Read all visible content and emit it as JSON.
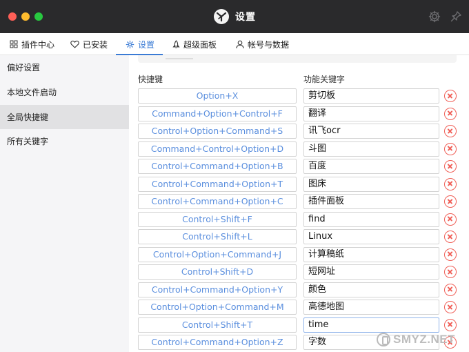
{
  "window": {
    "title": "设置"
  },
  "tabs": [
    {
      "label": "插件中心",
      "icon": "grid-icon"
    },
    {
      "label": "已安装",
      "icon": "heart-icon"
    },
    {
      "label": "设置",
      "icon": "gear-icon",
      "active": true
    },
    {
      "label": "超级面板",
      "icon": "rocket-icon"
    },
    {
      "label": "帐号与数据",
      "icon": "user-icon"
    }
  ],
  "sidebar": {
    "items": [
      {
        "label": "偏好设置"
      },
      {
        "label": "本地文件启动"
      },
      {
        "label": "全局快捷键",
        "active": true
      },
      {
        "label": "所有关键字"
      }
    ]
  },
  "table": {
    "col_shortcut": "快捷键",
    "col_keyword": "功能关键字",
    "rows": [
      {
        "shortcut": "Option+X",
        "keyword": "剪切板"
      },
      {
        "shortcut": "Command+Option+Control+F",
        "keyword": "翻译"
      },
      {
        "shortcut": "Control+Option+Command+S",
        "keyword": "讯飞ocr"
      },
      {
        "shortcut": "Command+Control+Option+D",
        "keyword": "斗图"
      },
      {
        "shortcut": "Control+Command+Option+B",
        "keyword": "百度"
      },
      {
        "shortcut": "Control+Command+Option+T",
        "keyword": "图床"
      },
      {
        "shortcut": "Control+Command+Option+C",
        "keyword": "插件面板"
      },
      {
        "shortcut": "Control+Shift+F",
        "keyword": "find"
      },
      {
        "shortcut": "Control+Shift+L",
        "keyword": "Linux"
      },
      {
        "shortcut": "Control+Option+Command+J",
        "keyword": "计算稿纸"
      },
      {
        "shortcut": "Control+Shift+D",
        "keyword": "短网址"
      },
      {
        "shortcut": "Control+Command+Option+Y",
        "keyword": "颜色"
      },
      {
        "shortcut": "Control+Option+Command+M",
        "keyword": "高德地图"
      },
      {
        "shortcut": "Control+Shift+T",
        "keyword": "time",
        "focused": true
      },
      {
        "shortcut": "Control+Command+Option+Z",
        "keyword": "字数"
      }
    ]
  },
  "watermark": {
    "text": "SMYZ.NET"
  },
  "colors": {
    "accent": "#3a7bd5",
    "shortcut_text": "#5b8fde",
    "delete": "#f06058",
    "titlebar": "#2a2a2c"
  }
}
